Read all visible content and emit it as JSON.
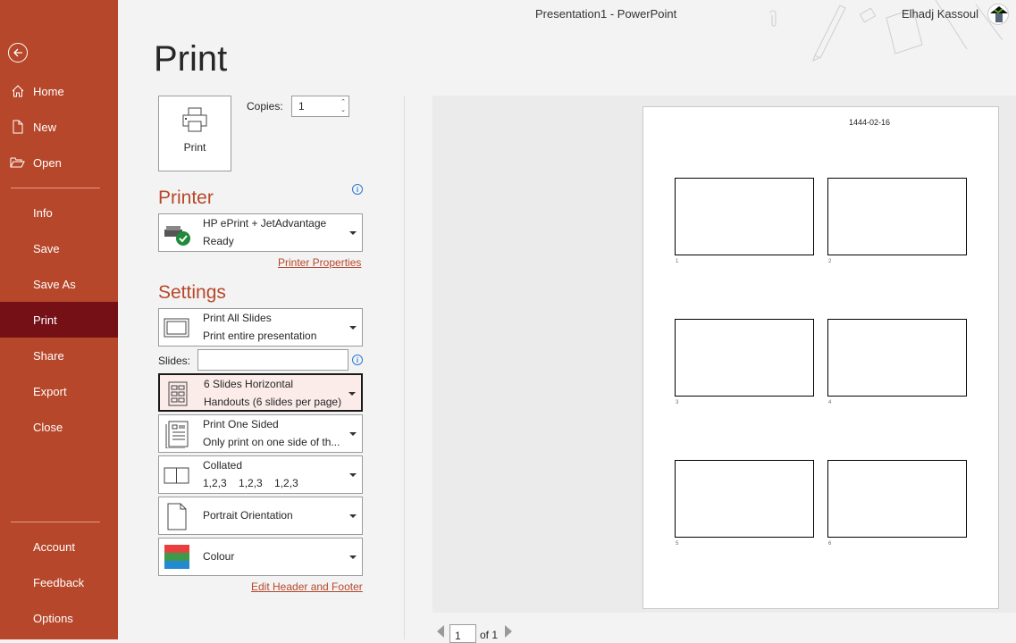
{
  "window": {
    "title": "Presentation1  -  PowerPoint",
    "user": "Elhadj Kassoul"
  },
  "sidebar": {
    "items": [
      {
        "label": "Home",
        "icon": "home-icon"
      },
      {
        "label": "New",
        "icon": "new-document-icon"
      },
      {
        "label": "Open",
        "icon": "folder-open-icon"
      },
      {
        "label": "Info"
      },
      {
        "label": "Save"
      },
      {
        "label": "Save As"
      },
      {
        "label": "Print",
        "active": true
      },
      {
        "label": "Share"
      },
      {
        "label": "Export"
      },
      {
        "label": "Close"
      },
      {
        "label": "Account"
      },
      {
        "label": "Feedback"
      },
      {
        "label": "Options"
      }
    ]
  },
  "page_title": "Print",
  "print_button": {
    "label": "Print"
  },
  "copies": {
    "label": "Copies:",
    "value": "1"
  },
  "printer": {
    "heading": "Printer",
    "name": "HP ePrint + JetAdvantage",
    "status": "Ready",
    "properties_link": "Printer Properties"
  },
  "settings": {
    "heading": "Settings",
    "range": {
      "title": "Print All Slides",
      "subtitle": "Print entire presentation"
    },
    "slides_label": "Slides:",
    "slides_value": "",
    "layout": {
      "title": "6 Slides Horizontal",
      "subtitle": "Handouts (6 slides per page)"
    },
    "sides": {
      "title": "Print One Sided",
      "subtitle": "Only print on one side of th..."
    },
    "collation": {
      "title": "Collated",
      "subtitle": "1,2,3    1,2,3    1,2,3"
    },
    "orientation": {
      "title": "Portrait Orientation"
    },
    "color": {
      "title": "Colour",
      "colors": [
        "#e8403f",
        "#3c9a4a",
        "#2389d1"
      ]
    },
    "header_footer_link": "Edit Header and Footer"
  },
  "preview": {
    "date": "1444-02-16",
    "slide_numbers": [
      "1",
      "2",
      "3",
      "4",
      "5",
      "6"
    ],
    "page_current": "1",
    "page_of": "of 1"
  },
  "colors": {
    "accent": "#b7472a",
    "active_nav": "#741016"
  }
}
